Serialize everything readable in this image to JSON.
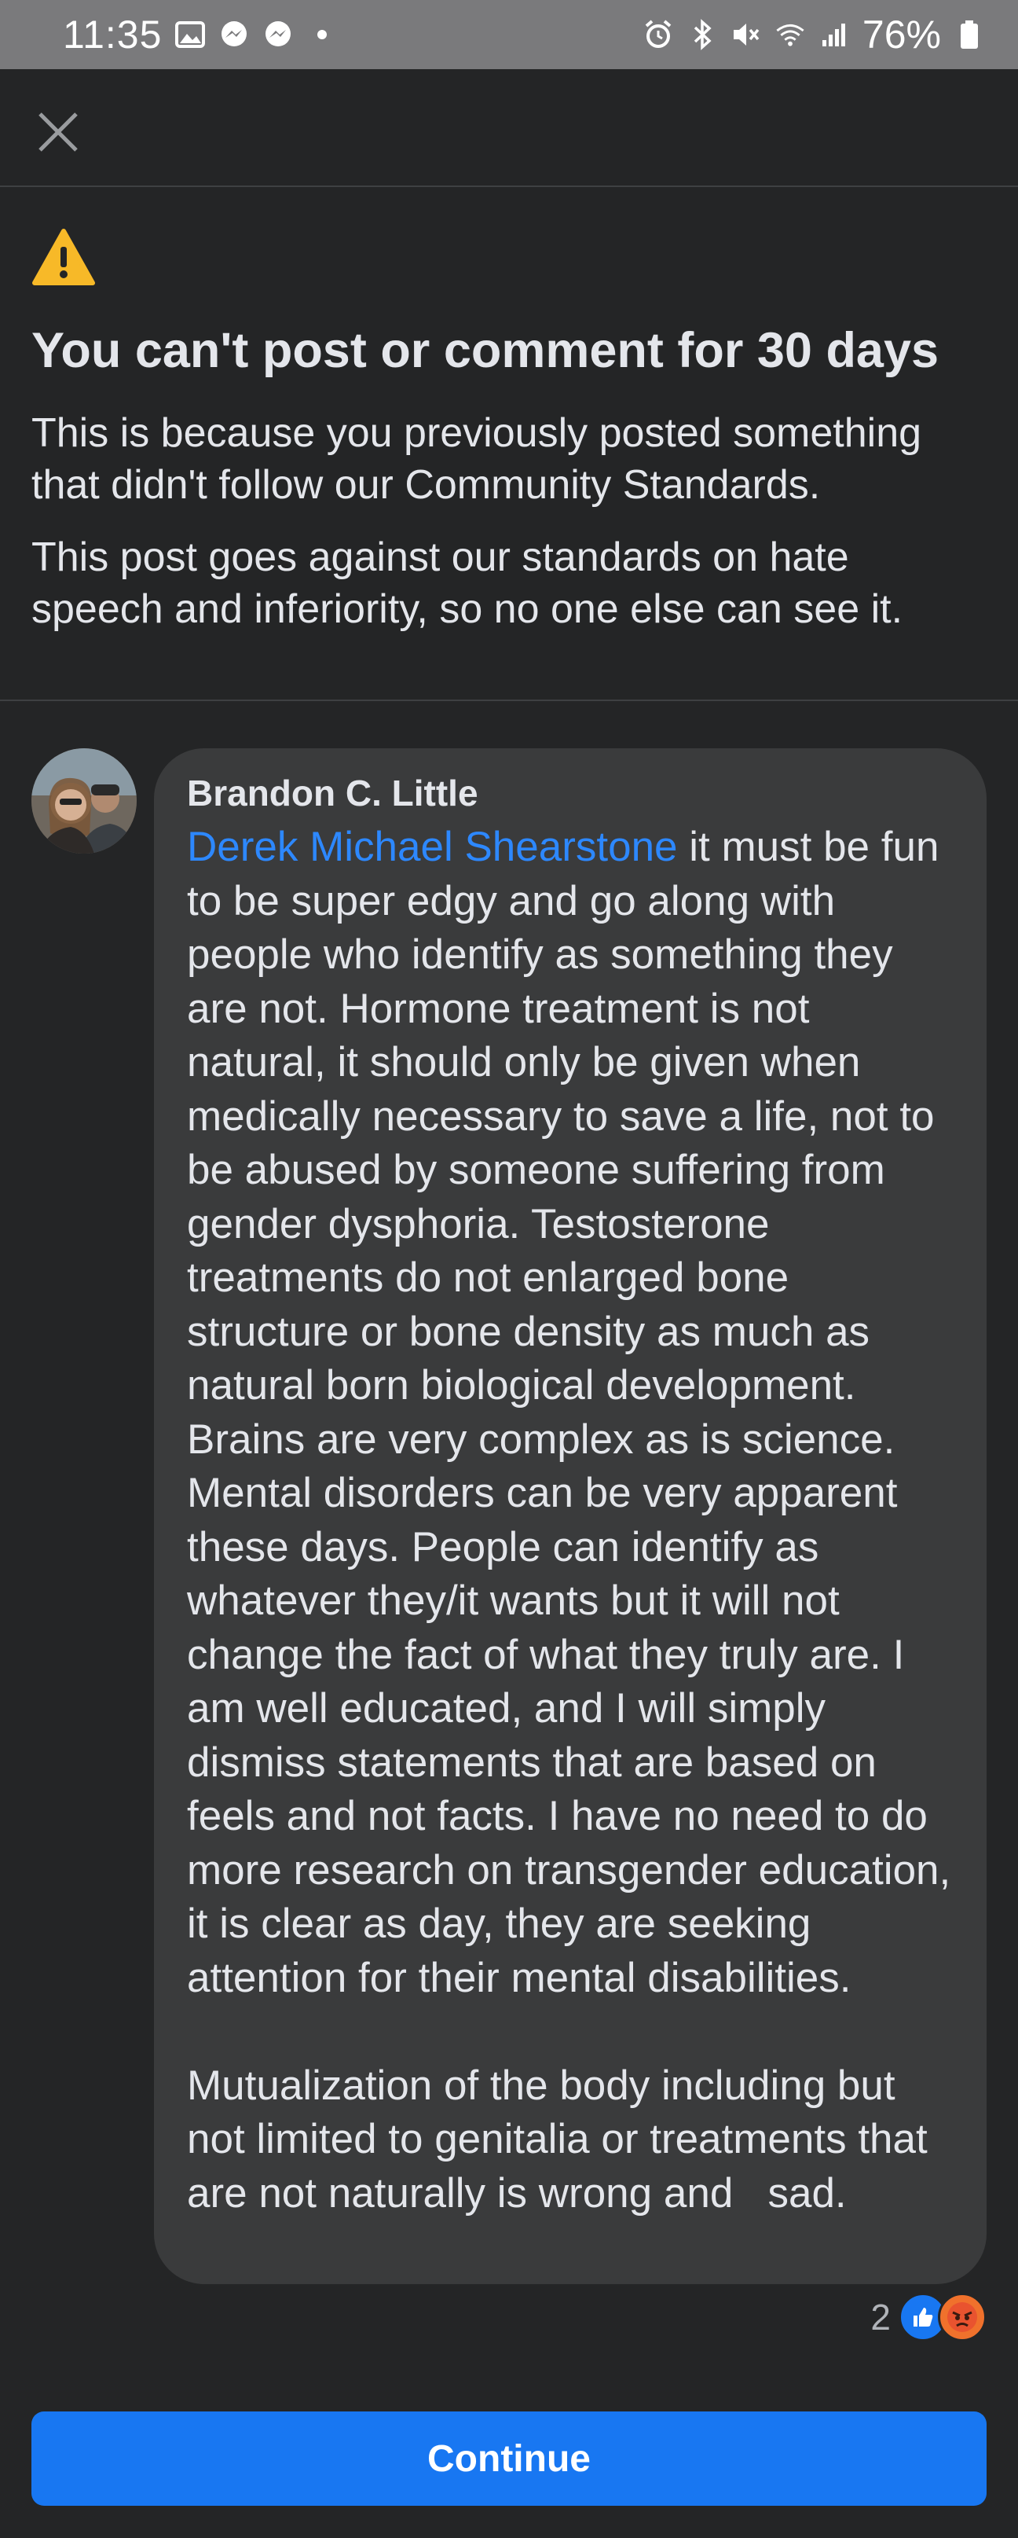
{
  "status_bar": {
    "time": "11:35",
    "battery": "76%",
    "left_icons": [
      "gallery-icon",
      "messenger-icon",
      "messenger-icon",
      "dot-icon"
    ],
    "right_icons": [
      "alarm-icon",
      "bluetooth-icon",
      "mute-icon",
      "wifi-icon",
      "signal-icon",
      "battery-icon"
    ]
  },
  "header": {
    "close_icon": "close-icon"
  },
  "notice": {
    "icon": "warning-icon",
    "title": "You can't post or comment for 30 days",
    "paragraph1": "This is because you previously posted something that didn't follow our Community Standards.",
    "paragraph2": "This post goes against our standards on hate speech and inferiority, so no one else can see it."
  },
  "comment": {
    "author": "Brandon C. Little",
    "mention": "Derek Michael Shearstone",
    "text": " it must be fun to be super edgy and go along with people who identify as something they are not. Hormone treatment is not natural, it should only be given when medically necessary to save a life, not to be abused by someone suffering from gender dysphoria. Testosterone treatments do not enlarged bone structure or bone density as much as natural born biological development. Brains are very complex as is science. Mental disorders can be very apparent these days. People can identify as whatever they/it wants but it will not change the fact of what they truly are. I am well educated, and I will simply dismiss statements that are based on feels and not facts. I have no need to do more research on transgender education, it is clear as day, they are seeking attention for their mental disabilities.\n\nMutualization of the body including but not limited to genitalia or treatments that are not naturally is wrong and   sad.",
    "reaction_count": "2",
    "reactions": [
      "like-icon",
      "angry-icon"
    ]
  },
  "footer": {
    "continue_label": "Continue"
  },
  "colors": {
    "background": "#242526",
    "bubble": "#3a3b3c",
    "accent": "#1877f2",
    "mention": "#2d88ff",
    "warning": "#f7b928"
  }
}
